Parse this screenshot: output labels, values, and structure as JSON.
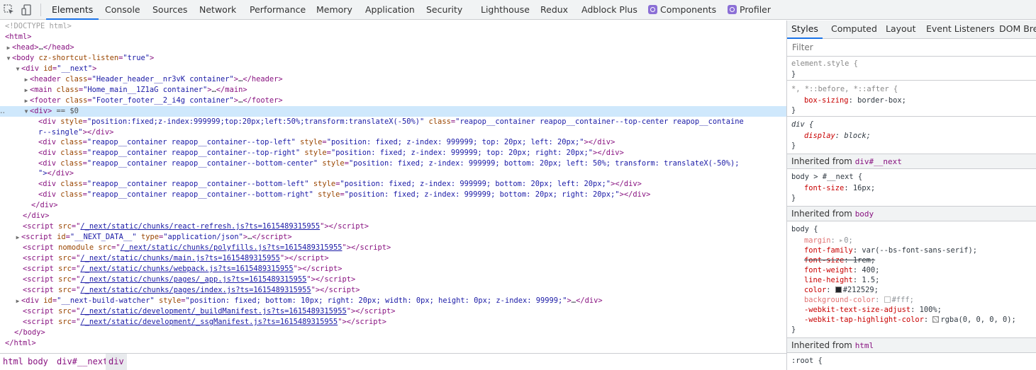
{
  "toolbar": {
    "tabs": [
      "Elements",
      "Console",
      "Sources",
      "Network",
      "Performance",
      "Memory",
      "Application",
      "Security",
      "Lighthouse",
      "Redux",
      "Adblock Plus",
      "Components",
      "Profiler"
    ],
    "active_tab": "Elements"
  },
  "dom": {
    "doctype": "<!DOCTYPE html>",
    "html_open": "<html>",
    "head_tag": "<head>",
    "head_close": "</head>",
    "body_tag": "<body",
    "body_attr": "cz-shortcut-listen",
    "body_attr_val": "\"true\"",
    "div_next_tag": "<div",
    "div_next_attr": "id",
    "div_next_val": "\"__next\"",
    "header_attr_val": "\"Header_header__nr3vK container\"",
    "header_close": "</header>",
    "main_attr_val": "\"Home_main__1Z1aG container\"",
    "main_close": "</main>",
    "footer_attr_val": "\"Footer_footer__2_i4g container\"",
    "footer_close": "</footer>",
    "selected_div": "<div>",
    "selected_hint": "== $0",
    "reapop_single_style": "\"position:fixed;z-index:999999;top:20px;left:50%;transform:translateX(-50%)\"",
    "reapop_single_class": "\"reapop__container reapop__container--top-center reapop__containe",
    "reapop_single_class_wrap": "r--single\"",
    "rows": [
      {
        "cls": "\"reapop__container reapop__container--top-left\"",
        "style": "\"position: fixed; z-index: 999999; top: 20px; left: 20px;\""
      },
      {
        "cls": "\"reapop__container reapop__container--top-right\"",
        "style": "\"position: fixed; z-index: 999999; top: 20px; right: 20px;\""
      },
      {
        "cls": "\"reapop__container reapop__container--bottom-center\"",
        "style": "\"position: fixed; z-index: 999999; bottom: 20px; left: 50%; transform: translateX(-50%);"
      },
      {
        "cls": "\"reapop__container reapop__container--bottom-left\"",
        "style": "\"position: fixed; z-index: 999999; bottom: 20px; left: 20px;\""
      },
      {
        "cls": "\"reapop__container reapop__container--bottom-right\"",
        "style": "\"position: fixed; z-index: 999999; bottom: 20px; right: 20px;\""
      }
    ],
    "bottom_center_wrap": "\">",
    "close_div": "</div>",
    "scripts": [
      {
        "attrs": [
          [
            "src",
            "/_next/static/chunks/react-refresh.js?ts=1615489315955"
          ]
        ],
        "link": true
      },
      {
        "attrs": [
          [
            "id",
            "\"__NEXT_DATA__\""
          ],
          [
            "type",
            "\"application/json\""
          ]
        ],
        "link": false,
        "collapsed": true
      },
      {
        "attrs": [
          [
            "nomodule",
            ""
          ],
          [
            "src",
            "/_next/static/chunks/polyfills.js?ts=1615489315955"
          ]
        ],
        "link": true
      },
      {
        "attrs": [
          [
            "src",
            "/_next/static/chunks/main.js?ts=1615489315955"
          ]
        ],
        "link": true
      },
      {
        "attrs": [
          [
            "src",
            "/_next/static/chunks/webpack.js?ts=1615489315955"
          ]
        ],
        "link": true
      },
      {
        "attrs": [
          [
            "src",
            "/_next/static/chunks/pages/_app.js?ts=1615489315955"
          ]
        ],
        "link": true
      },
      {
        "attrs": [
          [
            "src",
            "/_next/static/chunks/pages/index.js?ts=1615489315955"
          ]
        ],
        "link": true
      }
    ],
    "build_watcher_id": "\"__next-build-watcher\"",
    "build_watcher_style": "\"position: fixed; bottom: 10px; right: 20px; width: 0px; height: 0px; z-index: 99999;\"",
    "manifest_scripts": [
      "/_next/static/development/_buildManifest.js?ts=1615489315955",
      "/_next/static/development/_ssgManifest.js?ts=1615489315955"
    ],
    "body_close": "</body>",
    "html_close": "</html>"
  },
  "breadcrumb": [
    "html",
    "body",
    "div#__next",
    "div"
  ],
  "sidebar": {
    "tabs": [
      "Styles",
      "Computed",
      "Layout",
      "Event Listeners",
      "DOM Brea"
    ],
    "active_tab": "Styles",
    "filter_placeholder": "Filter",
    "element_style": "element.style {",
    "universal_selector": "*, *::before, *::after {",
    "box_sizing_prop": "box-sizing",
    "box_sizing_val": "border-box;",
    "div_selector": "div {",
    "display_prop": "display",
    "display_val": "block;",
    "inherited_label": "Inherited from",
    "inherited_next": "div#__next",
    "next_selector": "body > #__next {",
    "next_font_size_prop": "font-size",
    "next_font_size_val": "16px;",
    "inherited_body": "body",
    "body_selector": "body {",
    "body_props": [
      {
        "name": "margin",
        "value": "0;",
        "dim": true,
        "arrow": true
      },
      {
        "name": "font-family",
        "value": "var(--bs-font-sans-serif);",
        "var": true
      },
      {
        "name": "font-size",
        "value": "1rem;",
        "strike": true
      },
      {
        "name": "font-weight",
        "value": "400;"
      },
      {
        "name": "line-height",
        "value": "1.5;"
      },
      {
        "name": "color",
        "value": "#212529;",
        "swatch": "#212529"
      },
      {
        "name": "background-color",
        "value": "#fff;",
        "swatch": "#ffffff",
        "dim": true
      },
      {
        "name": "-webkit-text-size-adjust",
        "value": "100%;"
      },
      {
        "name": "-webkit-tap-highlight-color",
        "value": "rgba(0, 0, 0, 0);",
        "swatch": "transparent"
      }
    ],
    "inherited_html": "html",
    "root_selector": ":root {"
  }
}
